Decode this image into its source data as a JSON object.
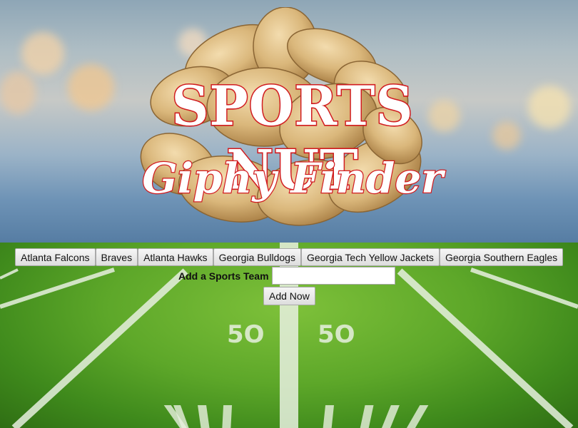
{
  "header": {
    "title": "SPORTS NUT",
    "subtitle": "Giphy Finder"
  },
  "teams": [
    {
      "label": "Atlanta Falcons"
    },
    {
      "label": "Braves"
    },
    {
      "label": "Atlanta Hawks"
    },
    {
      "label": "Georgia Bulldogs"
    },
    {
      "label": "Georgia Tech Yellow Jackets"
    },
    {
      "label": "Georgia Southern Eagles"
    }
  ],
  "form": {
    "label": "Add a Sports Team",
    "input_value": "",
    "submit_label": "Add Now"
  },
  "colors": {
    "logo_red": "#d11c20",
    "turf_green": "#5da729"
  }
}
